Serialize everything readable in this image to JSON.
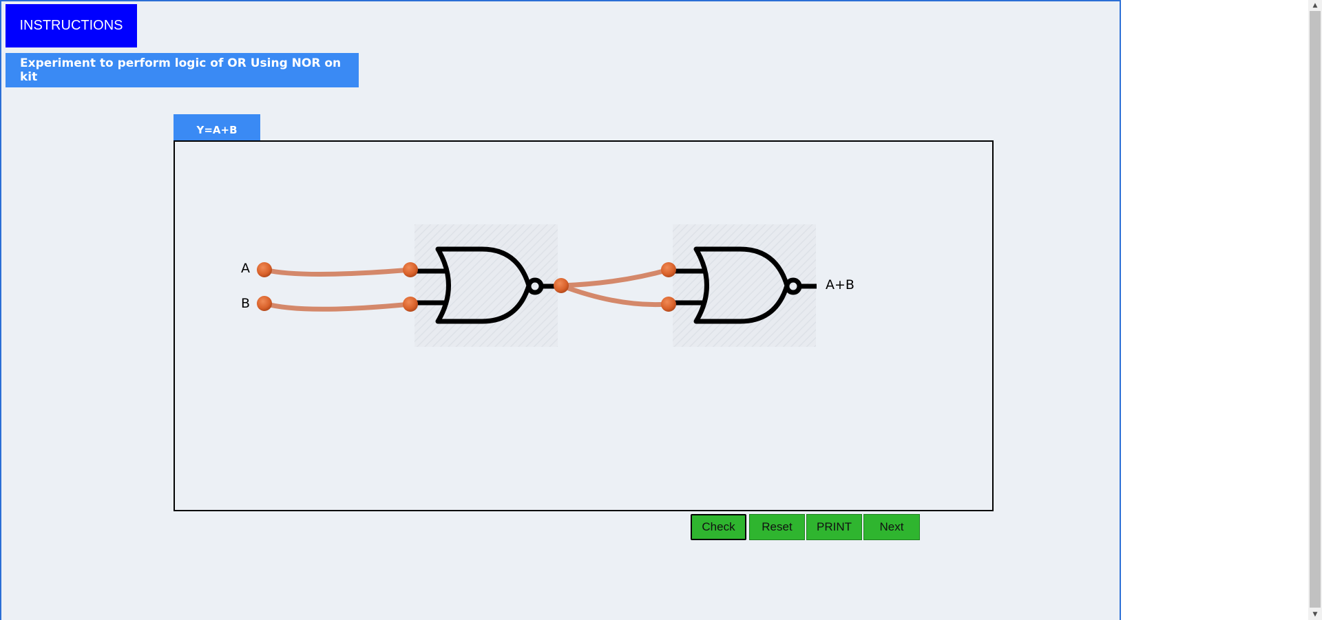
{
  "header": {
    "instructions_label": "INSTRUCTIONS",
    "experiment_title": "Experiment to perform logic of OR Using NOR on kit"
  },
  "workspace": {
    "equation_tab": "Y=A+B",
    "inputs": [
      {
        "label": "A"
      },
      {
        "label": "B"
      }
    ],
    "output_label": "A+B",
    "gates": [
      {
        "type": "NOR",
        "name": "gate-1"
      },
      {
        "type": "NOR",
        "name": "gate-2"
      }
    ],
    "wire_color": "#d4886a",
    "terminal_color": "#d9622b"
  },
  "controls": {
    "check_label": "Check",
    "reset_label": "Reset",
    "print_label": "PRINT",
    "next_label": "Next"
  },
  "colors": {
    "instructions_bg": "#0000ff",
    "title_bg": "#3a8af4",
    "button_green": "#2fb52f",
    "frame_border": "#2b6fd6"
  }
}
